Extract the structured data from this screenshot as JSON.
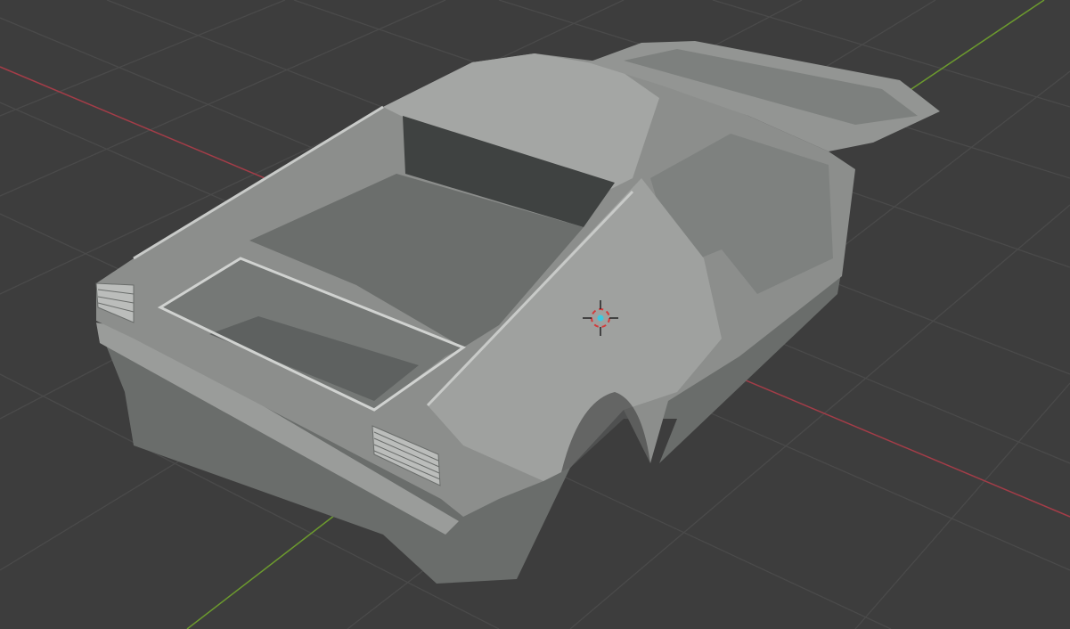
{
  "viewport": {
    "mode": "3d-viewport",
    "background_color": "#3d3d3d",
    "grid_color": "#4a4a4a",
    "x_axis_color": "#a33d48",
    "y_axis_color": "#6c9a2e",
    "object": {
      "name_icon": "car-body-mesh",
      "base_color": "#8c8e8c",
      "shadow_color": "#5d605e",
      "highlight_color": "#c8cac8"
    },
    "cursor": {
      "ring_color": "#d33a3a",
      "center_color": "#3ec9e0"
    }
  }
}
